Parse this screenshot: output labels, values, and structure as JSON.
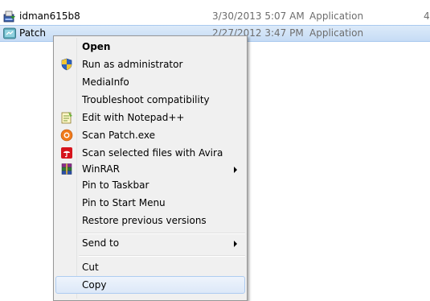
{
  "files": [
    {
      "name": "idman615b8",
      "date": "3/30/2013 5:07 AM",
      "type": "Application",
      "size": "4,",
      "icon": "idm-installer-icon",
      "selected": false
    },
    {
      "name": "Patch",
      "date": "2/27/2012 3:47 PM",
      "type": "Application",
      "size": "",
      "icon": "patch-app-icon",
      "selected": true
    }
  ],
  "context_menu": {
    "items": [
      {
        "label": "Open",
        "default": true
      },
      {
        "label": "Run as administrator",
        "icon": "uac-shield-icon"
      },
      {
        "label": "MediaInfo"
      },
      {
        "label": "Troubleshoot compatibility"
      },
      {
        "label": "Edit with Notepad++",
        "icon": "notepadpp-icon"
      },
      {
        "label": "Scan Patch.exe",
        "icon": "avast-scan-icon"
      },
      {
        "label": "Scan selected files with Avira",
        "icon": "avira-umbrella-icon"
      },
      {
        "label": "WinRAR",
        "icon": "winrar-books-icon",
        "submenu": true
      },
      {
        "label": "Pin to Taskbar"
      },
      {
        "label": "Pin to Start Menu"
      },
      {
        "label": "Restore previous versions"
      },
      {
        "label": "Send to",
        "submenu": true
      },
      {
        "label": "Cut"
      },
      {
        "label": "Copy",
        "highlighted": true
      }
    ]
  },
  "colors": {
    "selection": "#cce0f7",
    "menu_background": "#f0f0f0",
    "menu_hover_border": "#aeccf1"
  }
}
